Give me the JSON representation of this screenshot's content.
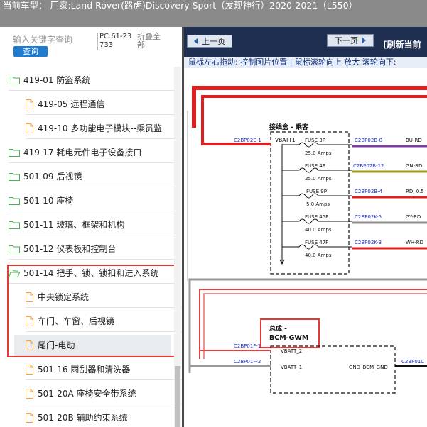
{
  "header": {
    "title": "当前车型： 厂家:Land Rover(路虎)Discovery Sport（发现神行）2020-2021（L550）"
  },
  "sidebar": {
    "search_placeholder": "输入关键字查询",
    "search_button": "查询",
    "pc_code": "PC.61-23733",
    "collapse_all": "折叠全部",
    "items": [
      {
        "label": "419-01 防盗系统"
      },
      {
        "label": "419-05 远程通信"
      },
      {
        "label": "419-10 多功能电子模块--乘员监"
      },
      {
        "label": "419-17 耗电元件电子设备接口"
      },
      {
        "label": "501-09 后视镜"
      },
      {
        "label": "501-10 座椅"
      },
      {
        "label": "501-11 玻璃、框架和机构"
      },
      {
        "label": "501-12 仪表板和控制台"
      },
      {
        "label": "501-14 把手、锁、锁扣和进入系统"
      },
      {
        "label": "中央锁定系统"
      },
      {
        "label": "车门、车窗、后视镜"
      },
      {
        "label": "尾门-电动"
      },
      {
        "label": "501-16 雨刮器和清洗器"
      },
      {
        "label": "501-20A 座椅安全带系统"
      },
      {
        "label": "501-20B 辅助约束系统"
      }
    ]
  },
  "toolbar": {
    "prev": "上一页",
    "next": "下一页",
    "refresh": "[刷新当前"
  },
  "hint": "鼠标左右拖动: 控制图片位置 | 鼠标滚轮向上 放大   滚轮向下: ",
  "diagram": {
    "junction_box_title": "接线盒 - 乘客",
    "vbatt1": "VBATT1",
    "left_connector": "C2BP02E-1",
    "fuses": [
      {
        "name": "FUSE 3P",
        "amps": "25.0 Amps",
        "connector": "C2BP02B-8",
        "wire": "BU-RD"
      },
      {
        "name": "FUSE 4P",
        "amps": "25.0 Amps",
        "connector": "C2BP02B-12",
        "wire": "GN-RD"
      },
      {
        "name": "FUSE 9P",
        "amps": "5.0 Amps",
        "connector": "C2BP02B-4",
        "wire": "RD, 0.5"
      },
      {
        "name": "FUSE 45P",
        "amps": "40.0 Amps",
        "connector": "C2BP02K-5",
        "wire": "GY-RD"
      },
      {
        "name": "FUSE 47P",
        "amps": "40.0 Amps",
        "connector": "C2BP02K-3",
        "wire": "WH-RD"
      }
    ],
    "bcm_title_line1": "总成 -",
    "bcm_title_line2": "BCM-GWM",
    "bcm_pins": [
      {
        "connector": "C2BP01F-1",
        "pin": "VBATT_2"
      },
      {
        "connector": "C2BP01F-2",
        "pin": "VBATT_1"
      }
    ],
    "bcm_gnd_pin": "GND_BCM_GND",
    "bcm_right_connector": "C2BP01C",
    "colors": {
      "wire_red": "#e02020",
      "wire_purple": "#7b3fa0",
      "wire_olive": "#9a9a1a",
      "wire_gray": "#8c8c8c",
      "highlight": "#e53935",
      "connector_blue": "#1c2fd0"
    }
  }
}
